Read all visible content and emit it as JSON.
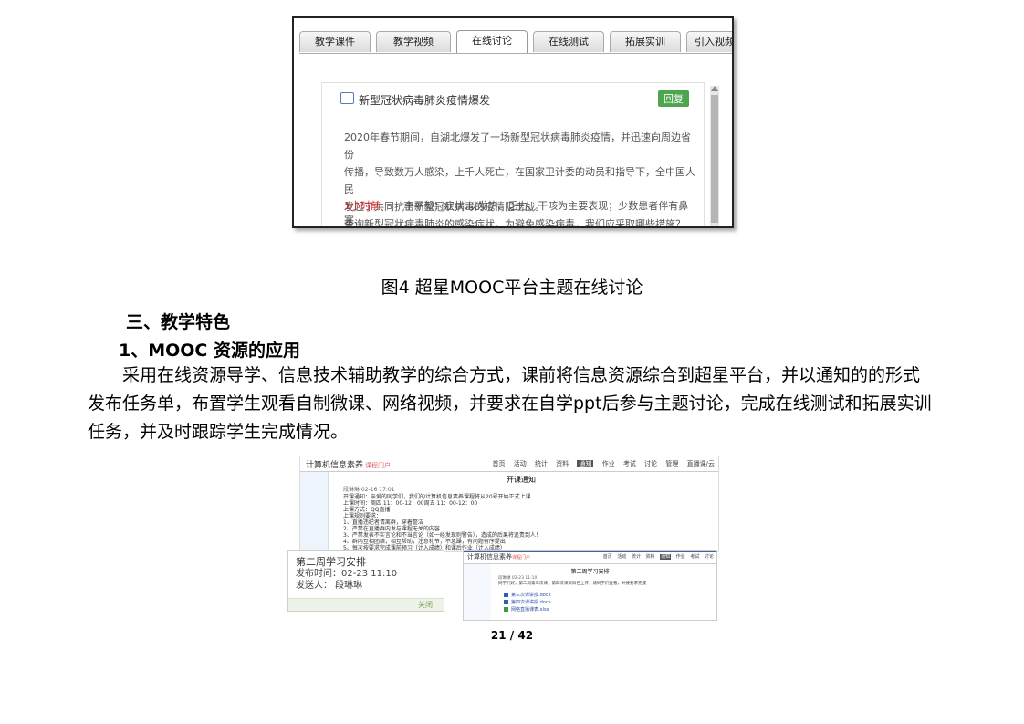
{
  "figure1": {
    "tabs": [
      "教学课件",
      "教学视频",
      "在线讨论",
      "在线测试",
      "拓展实训",
      "引入视频"
    ],
    "active_tab": "在线讨论",
    "topic_title": "新型冠状病毒肺炎疫情爆发",
    "reply_label": "回复",
    "body_lines": [
      "2020年春节期间，自湖北爆发了一场新型冠状病毒肺炎疫情，并迅速向周边省份",
      "传播，导致数万人感染，上千人死亡，在国家卫计委的动员和指导下，全中国人民",
      "发起了共同抗击新型冠状病毒的疫情阻击战。",
      "查询新型冠状病毒肺炎的感染症状，为避免感染病毒，我们应采取哪些措施？"
    ],
    "reply_time": "1小时前",
    "reply_text": "李平毅：症状:以发热、乏力、干咳为主要表现；少数患者伴有鼻塞、"
  },
  "caption": "图4  超星MOOC平台主题在线讨论",
  "heading1": "三、教学特色",
  "heading2": "1、MOOC 资源的应用",
  "paragraph": "采用在线资源导学、信息技术辅助教学的综合方式，课前将信息资源综合到超星平台，并以通知的的形式发布任务单，布置学生观看自制微课、网络视频，并要求在自学ppt后参与主题讨论，完成在线测试和拓展实训任务，并及时跟踪学生完成情况。",
  "figure2": {
    "top": {
      "brand": "计算机信息素养",
      "brand_sub": "课程门户",
      "nav": [
        "首页",
        "活动",
        "统计",
        "资料",
        "通知",
        "作业",
        "考试",
        "讨论",
        "管理",
        "直播课/云"
      ],
      "active_nav": "通知",
      "title": "开课通知",
      "meta": "段琳琳    02-16 17:01",
      "lines": [
        "开课通知：亲爱的同学们，我们的计算机信息素养课程将从20号开始正式上课",
        "上课时间：周四 11：00-12：00周五 11：00-12：00",
        "上课方式：QQ直播",
        "上课规则要求：",
        "1、直播违纪者请离群，穿着整洁",
        "2、严禁在直播群内发与课程无关的内容",
        "3、严禁发表不实言论和不当言论（如一经发现则警告），造成的后果将追责到人！",
        "4、群内互相团结，相互帮助，注意礼节，不急躁，有问题有序提出",
        "5、每次按要求完成课前预习（计入成绩）和课后作业（计入成绩）"
      ]
    },
    "notice": {
      "title": "第二周学习安排",
      "time": "发布时间：02-23 11:10",
      "sender": "发送人：  段琳琳",
      "foot": "关闭"
    },
    "bottom": {
      "brand": "计算机信息素养",
      "brand_sub": "课程门户",
      "nav": [
        "首页",
        "活动",
        "统计",
        "资料",
        "通知",
        "作业",
        "考试",
        "讨论"
      ],
      "active_nav": "通知",
      "title": "第二周学习安排",
      "meta": "段琳琳    02-23 11:10",
      "line": "同学们好，第二周第三次课，第四次课资料已上传，请同学们查看，并按要求完成",
      "files": [
        "第三次课讲授.docx",
        "第四次课讲授.docx",
        "网络直播课表.xlsx"
      ],
      "file_colors": [
        "#2d5fb4",
        "#2d5fb4",
        "#3c9a3c"
      ]
    }
  },
  "page_number": "21 / 42"
}
